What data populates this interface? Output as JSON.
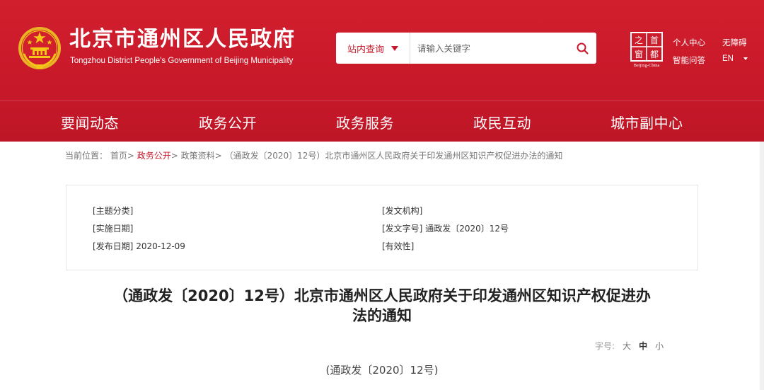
{
  "header": {
    "site_title": "北京市通州区人民政府",
    "site_subtitle": "Tongzhou District People's Government of Beijing Municipality",
    "emblem_icon": "national-emblem-icon",
    "search": {
      "scope_label": "站内查询",
      "placeholder": "请输入关键字",
      "search_icon": "search-icon"
    },
    "capital_logo": {
      "chars": [
        "之",
        "首",
        "窗",
        "都"
      ],
      "caption": "Beijing-China"
    },
    "links": {
      "personal_center": "个人中心",
      "accessibility": "无障碍",
      "smart_qa": "智能问答",
      "language": "EN"
    }
  },
  "nav": {
    "items": [
      "要闻动态",
      "政务公开",
      "政务服务",
      "政民互动",
      "城市副中心"
    ]
  },
  "breadcrumb": {
    "prefix": "当前位置：",
    "items": [
      "首页",
      "政务公开",
      "政策资料",
      "（通政发〔2020〕12号）北京市通州区人民政府关于印发通州区知识产权促进办法的通知"
    ],
    "separator": ">"
  },
  "meta": {
    "topic_label": "[主题分类]",
    "topic_value": "",
    "issuer_label": "[发文机构]",
    "issuer_value": "",
    "effective_label": "[实施日期]",
    "effective_value": "",
    "doc_no_label": "[发文字号]",
    "doc_no_value": "通政发〔2020〕12号",
    "publish_label": "[发布日期]",
    "publish_value": "2020-12-09",
    "validity_label": "[有效性]",
    "validity_value": ""
  },
  "document": {
    "title_line1": "（通政发〔2020〕12号）北京市通州区人民政府关于印发通州区知识产权促进办",
    "title_line2": "法的通知",
    "number": "(通政发〔2020〕12号)"
  },
  "font_size": {
    "label": "字号:",
    "large": "大",
    "medium": "中",
    "small": "小"
  },
  "colors": {
    "brand_red": "#c8192a",
    "header_red": "#d21f2d",
    "gold": "#f5c518"
  }
}
